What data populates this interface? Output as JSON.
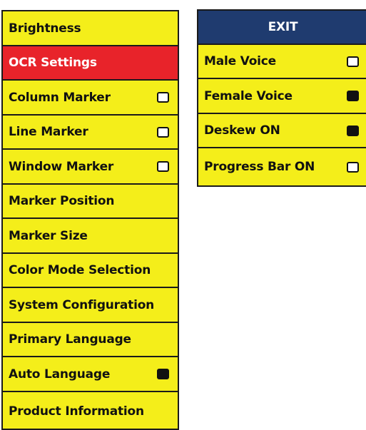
{
  "main_menu": {
    "items": [
      {
        "label": "Brightness"
      },
      {
        "label": "OCR Settings"
      },
      {
        "label": "Column Marker",
        "checked": false
      },
      {
        "label": "Line Marker",
        "checked": false
      },
      {
        "label": "Window Marker",
        "checked": false
      },
      {
        "label": "Marker Position"
      },
      {
        "label": "Marker Size"
      },
      {
        "label": "Color Mode Selection"
      },
      {
        "label": "System Configuration"
      },
      {
        "label": "Primary Language"
      },
      {
        "label": "Auto Language",
        "checked": true
      },
      {
        "label": "Product Information"
      }
    ]
  },
  "ocr_menu": {
    "exit_label": "EXIT",
    "items": [
      {
        "label": "Male Voice",
        "checked": false
      },
      {
        "label": "Female Voice",
        "checked": true
      },
      {
        "label": "Deskew ON",
        "checked": true
      },
      {
        "label": "Progress Bar ON",
        "checked": false
      }
    ]
  },
  "colors": {
    "menu_background": "#f4ee1a",
    "selected_background": "#e8232a",
    "header_background": "#1f3b6f",
    "border": "#1a1a1a",
    "checkbox_on": "#111111",
    "checkbox_off": "#ffffff"
  }
}
